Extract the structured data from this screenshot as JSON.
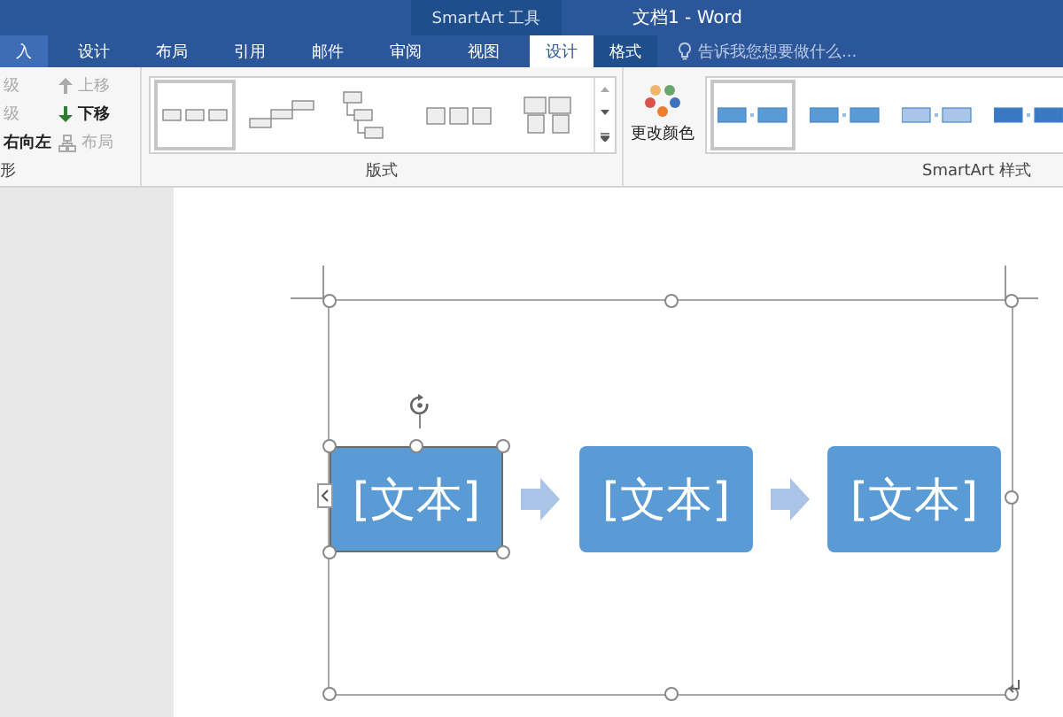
{
  "title_bar": {
    "context_label": "SmartArt 工具",
    "title": "文档1 - Word"
  },
  "tabs": [
    {
      "label": "入",
      "selected": false,
      "contextual": false,
      "hover": true
    },
    {
      "label": "设计",
      "selected": false,
      "contextual": false,
      "hover": false
    },
    {
      "label": "布局",
      "selected": false,
      "contextual": false,
      "hover": false
    },
    {
      "label": "引用",
      "selected": false,
      "contextual": false,
      "hover": false
    },
    {
      "label": "邮件",
      "selected": false,
      "contextual": false,
      "hover": false
    },
    {
      "label": "审阅",
      "selected": false,
      "contextual": false,
      "hover": false
    },
    {
      "label": "视图",
      "selected": false,
      "contextual": false,
      "hover": false
    },
    {
      "label": "设计",
      "selected": true,
      "contextual": true,
      "hover": false
    },
    {
      "label": "格式",
      "selected": false,
      "contextual": true,
      "hover": false
    }
  ],
  "tell_me": {
    "placeholder": "告诉我您想要做什么..."
  },
  "create_group": {
    "label": "形",
    "items": [
      {
        "label": "级",
        "disabled": true
      },
      {
        "label": "级",
        "disabled": true
      },
      {
        "label": "右向左",
        "disabled": false
      }
    ]
  },
  "move_buttons": [
    {
      "label": "上移",
      "kind": "up",
      "disabled": true
    },
    {
      "label": "下移",
      "kind": "down",
      "disabled": false
    },
    {
      "label": "布局",
      "kind": "layout",
      "disabled": true
    }
  ],
  "layouts": {
    "label": "版式",
    "items": [
      {
        "kind": "process",
        "selected": true
      },
      {
        "kind": "steps",
        "selected": false
      },
      {
        "kind": "tree",
        "selected": false
      },
      {
        "kind": "chain",
        "selected": false
      },
      {
        "kind": "cards",
        "selected": false
      }
    ]
  },
  "color_button": {
    "label": "更改颜色"
  },
  "styles": {
    "label": "SmartArt 样式",
    "items": [
      {
        "kind": "flat",
        "selected": true
      },
      {
        "kind": "flat",
        "selected": false
      },
      {
        "kind": "light",
        "selected": false
      },
      {
        "kind": "dark",
        "selected": false
      }
    ]
  },
  "smartart": {
    "nodes": [
      {
        "text": "[文本]",
        "selected": true
      },
      {
        "text": "[文本]",
        "selected": false
      },
      {
        "text": "[文本]",
        "selected": false
      }
    ]
  }
}
